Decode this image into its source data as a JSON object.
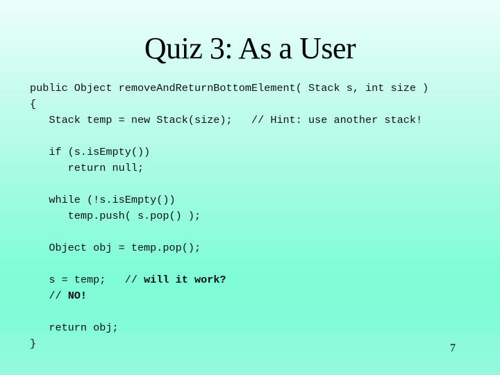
{
  "slide": {
    "title": "Quiz 3: As a User",
    "page_number": "7",
    "code_lines": [
      {
        "text": "public Object removeAndReturnBottomElement( Stack s, int size )"
      },
      {
        "text": "{"
      },
      {
        "text": "   Stack temp = new Stack(size);   // Hint: use another stack!"
      },
      {
        "text": "   if (s.isEmpty())"
      },
      {
        "text": "      return null;"
      },
      {
        "text": "   while (!s.isEmpty())"
      },
      {
        "text": "      temp.push( s.pop() );"
      },
      {
        "text": "   Object obj = temp.pop();"
      },
      {
        "code": "   s = temp;   ",
        "comment_prefix": "// ",
        "comment_bold": "will it work?"
      },
      {
        "code": "   ",
        "comment_prefix": "// ",
        "comment_bold": "NO!"
      },
      {
        "text": "   return obj;"
      },
      {
        "text": "}"
      }
    ]
  },
  "colors": {
    "background_top": "#ecfffa",
    "background_mid": "#80fdd6",
    "text": "#000000"
  }
}
